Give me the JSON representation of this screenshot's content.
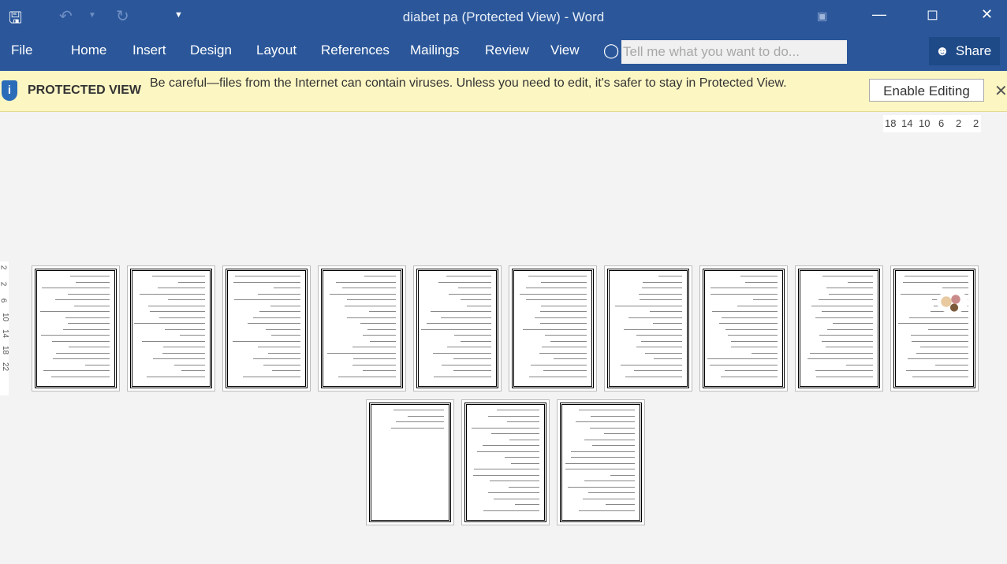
{
  "window": {
    "title": "diabet pa (Protected View) - Word"
  },
  "quick_access": {
    "save_icon": "save-icon",
    "undo_icon": "undo-icon",
    "redo_icon": "redo-icon",
    "customize_icon": "customize-icon"
  },
  "ribbon": {
    "tabs": [
      "File",
      "Home",
      "Insert",
      "Design",
      "Layout",
      "References",
      "Mailings",
      "Review",
      "View"
    ],
    "tell_me_placeholder": "Tell me what you want to do...",
    "share_label": "Share"
  },
  "protected_view": {
    "label": "PROTECTED VIEW",
    "message": "Be careful—files from the Internet can contain viruses. Unless you need to edit, it's safer to stay in Protected View.",
    "enable_label": "Enable Editing"
  },
  "ruler": {
    "ticks": [
      "18",
      "14",
      "10",
      "6",
      "2",
      "2"
    ]
  },
  "vertical_ruler": {
    "ticks": [
      "2",
      "2",
      "6",
      "10",
      "14",
      "18",
      "22"
    ]
  },
  "document": {
    "page_count": 13
  },
  "colors": {
    "title_bar": "#2b579a",
    "protected_bar": "#fcf6c3"
  }
}
